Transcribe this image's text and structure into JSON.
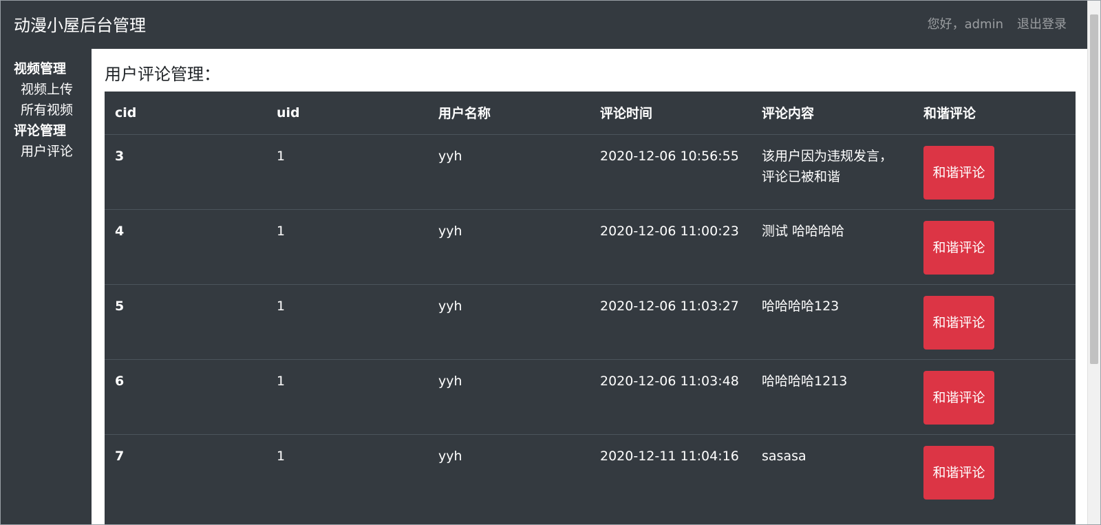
{
  "navbar": {
    "brand": "动漫小屋后台管理",
    "greeting": "您好，admin",
    "logout": "退出登录"
  },
  "sidebar": {
    "groups": [
      {
        "label": "视频管理",
        "items": [
          "视频上传",
          "所有视频"
        ]
      },
      {
        "label": "评论管理",
        "items": [
          "用户评论"
        ]
      }
    ]
  },
  "main": {
    "title": "用户评论管理：",
    "table": {
      "headers": [
        "cid",
        "uid",
        "用户名称",
        "评论时间",
        "评论内容",
        "和谐评论"
      ],
      "rows": [
        {
          "cid": "3",
          "uid": "1",
          "username": "yyh",
          "time": "2020-12-06 10:56:55",
          "content": "该用户因为违规发言，评论已被和谐",
          "action": "和谐评论"
        },
        {
          "cid": "4",
          "uid": "1",
          "username": "yyh",
          "time": "2020-12-06 11:00:23",
          "content": "测试 哈哈哈哈",
          "action": "和谐评论"
        },
        {
          "cid": "5",
          "uid": "1",
          "username": "yyh",
          "time": "2020-12-06 11:03:27",
          "content": "哈哈哈哈123",
          "action": "和谐评论"
        },
        {
          "cid": "6",
          "uid": "1",
          "username": "yyh",
          "time": "2020-12-06 11:03:48",
          "content": "哈哈哈哈1213",
          "action": "和谐评论"
        },
        {
          "cid": "7",
          "uid": "1",
          "username": "yyh",
          "time": "2020-12-11 11:04:16",
          "content": "sasasa",
          "action": "和谐评论"
        }
      ]
    }
  },
  "colors": {
    "dark": "#343a40",
    "danger": "#dc3545"
  }
}
